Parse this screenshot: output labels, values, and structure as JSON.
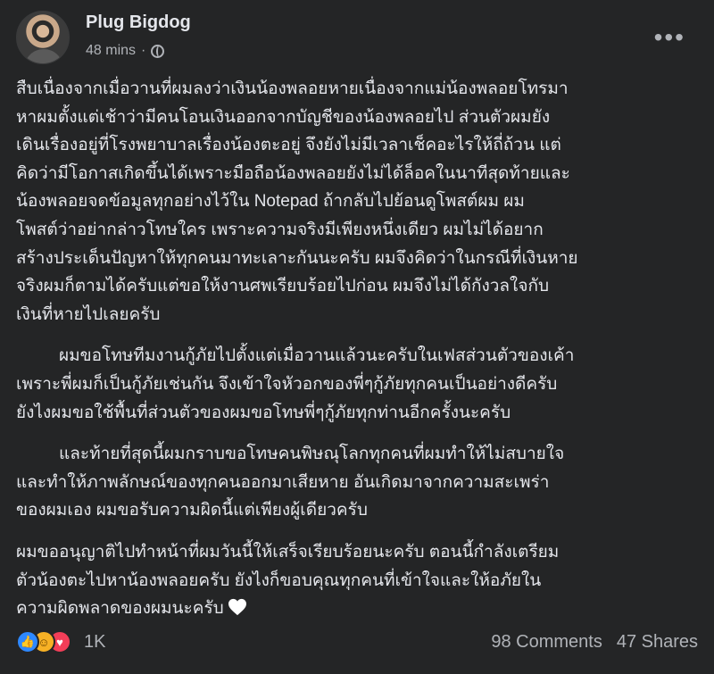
{
  "post": {
    "author": "Plug Bigdog",
    "time": "48 mins",
    "separator": "·",
    "privacy_icon": "globe-icon",
    "more_icon": "more-horizontal-icon",
    "paragraphs": [
      [
        "สืบเนื่องจากเมื่อวานที่ผมลงว่าเงินน้องพลอยหายเนื่องจากแม่น้องพลอยโทรมา",
        "หาผมตั้งแต่เช้าว่ามีคนโอนเงินออกจากบัญชีของน้องพลอยไป ส่วนตัวผมยัง",
        "เดินเรื่องอยู่ที่โรงพยาบาลเรื่องน้องตะอยู่ จึงยังไม่มีเวลาเช็คอะไรให้ถี่ถ้วน แต่",
        "คิดว่ามีโอกาสเกิดขึ้นได้เพราะมือถือน้องพลอยยังไม่ได้ล็อคในนาทีสุดท้ายและ",
        "น้องพลอยจดข้อมูลทุกอย่างไว้ใน Notepad ถ้ากลับไปย้อนดูโพสต์ผม ผม",
        "โพสต์ว่าอย่ากล่าวโทษใคร เพราะความจริงมีเพียงหนึ่งเดียว ผมไม่ได้อยาก",
        "สร้างประเด็นปัญหาให้ทุกคนมาทะเลาะกันนะครับ ผมจึงคิดว่าในกรณีที่เงินหาย",
        "จริงผมก็ตามได้ครับแต่ขอให้งานศพเรียบร้อยไปก่อน ผมจึงไม่ได้กังวลใจกับ",
        "เงินที่หายไปเลยครับ"
      ],
      [
        "ผมขอโทษทีมงานกู้ภัยไปตั้งแต่เมื่อวานแล้วนะครับในเฟสส่วนตัวของเค้า",
        "เพราะพี่ผมก็เป็นกู้ภัยเช่นกัน จึงเข้าใจหัวอกของพี่ๆกู้ภัยทุกคนเป็นอย่างดีครับ",
        "ยังไงผมขอใช้พื้นที่ส่วนตัวของผมขอโทษพี่ๆกู้ภัยทุกท่านอีกครั้งนะครับ"
      ],
      [
        "และท้ายที่สุดนี้ผมกราบขอโทษคนพิษณุโลกทุกคนที่ผมทำให้ไม่สบายใจ",
        "และทำให้ภาพลักษณ์ของทุกคนออกมาเสียหาย อันเกิดมาจากความสะเพร่า",
        "ของผมเอง ผมขอรับความผิดนี้แต่เพียงผู้เดียวครับ"
      ],
      [
        "ผมขออนุญาติไปทำหน้าที่ผมวันนี้ให้เสร็จเรียบร้อยนะครับ ตอนนี้กำลังเตรียม",
        "ตัวน้องตะไปหาน้องพลอยครับ ยังไงก็ขอบคุณทุกคนที่เข้าใจและให้อภัยใน",
        "ความผิดพลาดของผมนะครับ"
      ]
    ],
    "end_emoji": "white-heart-icon",
    "reactions": {
      "icons": [
        "like-icon",
        "care-icon",
        "love-icon"
      ],
      "count": "1K"
    },
    "comments": "98 Comments",
    "shares": "47 Shares"
  }
}
